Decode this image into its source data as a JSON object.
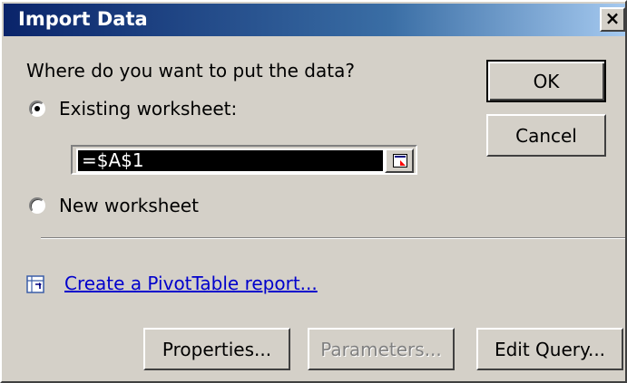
{
  "window": {
    "title": "Import Data",
    "close_label": "×"
  },
  "prompt": "Where do you want to put the data?",
  "options": {
    "existing_label": "Existing worksheet:",
    "existing_selected": true,
    "range_value": "=$A$1",
    "new_label": "New worksheet",
    "new_selected": false
  },
  "pivot": {
    "label": "Create a PivotTable report...",
    "icon": "pivottable-icon"
  },
  "buttons": {
    "ok": "OK",
    "cancel": "Cancel",
    "properties": "Properties...",
    "parameters": "Parameters...",
    "edit_query": "Edit Query..."
  },
  "colors": {
    "dialog_face": "#d4d0c8",
    "title_start": "#0a246a",
    "title_end": "#a6caf0",
    "link": "#0000cc",
    "selection_bg": "#000000"
  }
}
